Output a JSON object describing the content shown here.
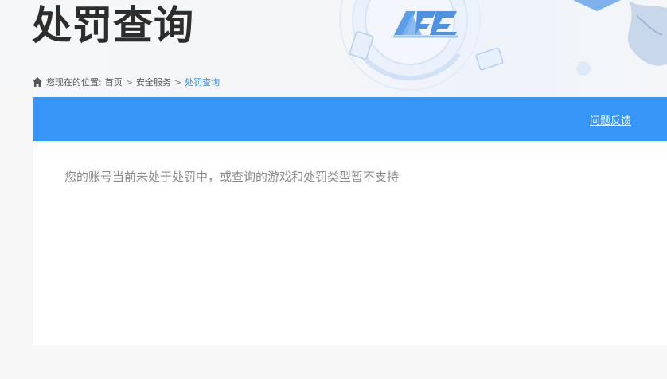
{
  "header": {
    "title": "处罚查询",
    "logo_text": "ACE"
  },
  "breadcrumb": {
    "prefix": "您现在的位置:",
    "items": [
      "首页",
      "安全服务",
      "处罚查询"
    ],
    "separator": ">"
  },
  "panel": {
    "feedback_label": "问题反馈",
    "message": "您的账号当前未处于处罚中，或查询的游戏和处罚类型暂不支持"
  },
  "colors": {
    "accent": "#3795f7",
    "current_crumb": "#2f8ae6",
    "title": "#2d2d2d",
    "message": "#8a8a8a"
  },
  "icons": [
    "home-icon",
    "ace-logo-icon",
    "game-card-icon"
  ]
}
